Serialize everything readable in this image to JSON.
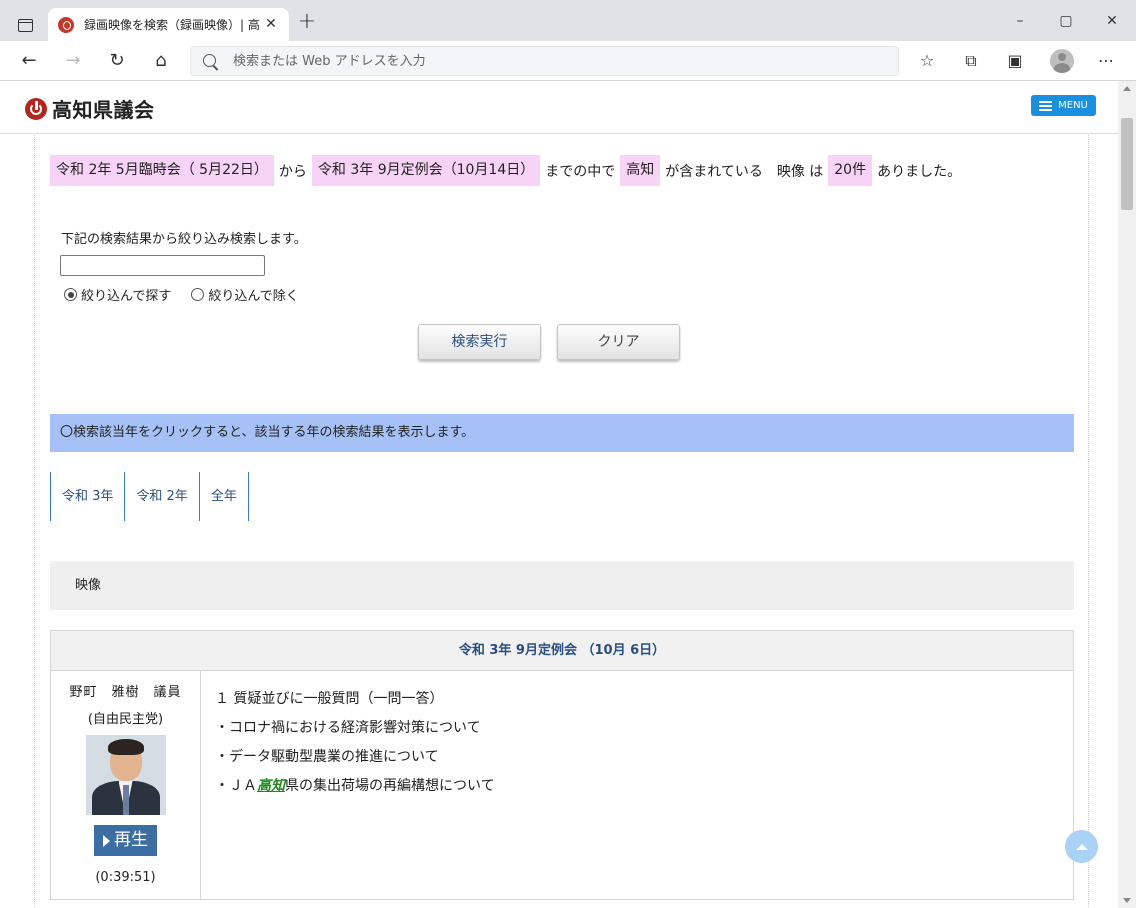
{
  "browser": {
    "tab_title": "録画映像を検索（録画映像）| 高",
    "tab_close": "✕",
    "new_tab": "+",
    "address_placeholder": "検索または Web アドレスを入力",
    "window_minimize": "–",
    "window_maximize": "▢",
    "window_close": "✕"
  },
  "site": {
    "logo_text": "高知県議会",
    "menu_label": "MENU"
  },
  "summary": {
    "from_session": "令和 2年 5月臨時会（ 5月22日）",
    "from_word": "から",
    "to_session": "令和 3年 9月定例会（10月14日）",
    "within_word": "までの中で",
    "keyword": "高知",
    "contains_word": "が含まれている　映像 は",
    "count": "20件",
    "result_word": "ありました。"
  },
  "narrow": {
    "label": "下記の検索結果から絞り込み検索します。",
    "input_value": "",
    "radio_include": "絞り込んで探す",
    "radio_exclude": "絞り込んで除く",
    "radio_selected": "include",
    "search_button": "検索実行",
    "clear_button": "クリア"
  },
  "year_filter": {
    "notice": "〇検索該当年をクリックすると、該当する年の検索結果を表示します。",
    "tabs": [
      "令和 3年",
      "令和 2年",
      "全年"
    ]
  },
  "section": {
    "heading": "映像"
  },
  "result": {
    "session_title": "令和 3年 9月定例会 （10月 6日）",
    "member_name": "野町　雅樹　議員",
    "member_party": "(自由民主党)",
    "play_label": "再生",
    "duration": "(0:39:51)",
    "agenda_title": "１ 質疑並びに一般質問（一問一答）",
    "agenda_item_1": "・コロナ禍における経済影響対策について",
    "agenda_item_2": "・データ駆動型農業の推進について",
    "agenda_item_3_prefix": "・ＪＡ",
    "agenda_item_3_keyword": "高知",
    "agenda_item_3_suffix": "県の集出荷場の再編構想について"
  },
  "colors": {
    "highlight": "#f7d4f7",
    "year_bar": "#a6c1f5",
    "menu_button": "#1a8fe0",
    "play_button": "#3d6ea3",
    "keyword_green": "#1f8a1f"
  }
}
